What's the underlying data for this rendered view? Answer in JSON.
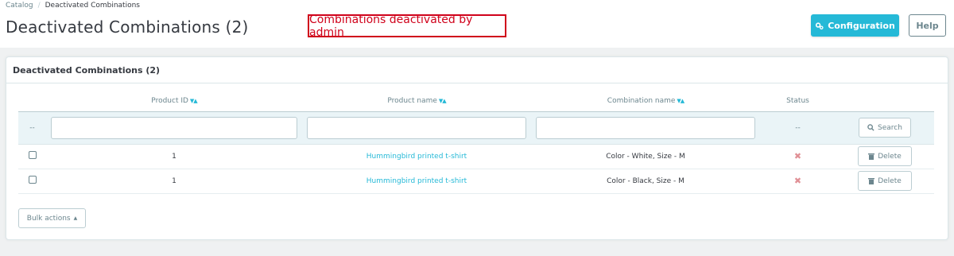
{
  "breadcrumb": {
    "parent": "Catalog",
    "separator": "/",
    "current": "Deactivated Combinations"
  },
  "header": {
    "title": "Deactivated Combinations (2)",
    "annotation": "Combinations deactivated by admin",
    "configuration_label": "Configuration",
    "help_label": "Help"
  },
  "panel": {
    "heading": "Deactivated Combinations (2)"
  },
  "table": {
    "columns": [
      "Product ID",
      "Product name",
      "Combination name",
      "Status"
    ],
    "filter_dash": "--",
    "status_dash": "--",
    "search_label": "Search",
    "rows": [
      {
        "product_id": "1",
        "product_name": "Hummingbird printed t-shirt",
        "combination": "Color - White, Size - M",
        "action": "Delete"
      },
      {
        "product_id": "1",
        "product_name": "Hummingbird printed t-shirt",
        "combination": "Color - Black, Size - M",
        "action": "Delete"
      }
    ]
  },
  "bulk_actions_label": "Bulk actions",
  "colors": {
    "accent": "#25b9d7",
    "annotation": "#d0021b",
    "status_disabled": "#e08f95"
  },
  "icons": {
    "config": "cogs-icon",
    "search": "search-icon",
    "delete": "trash-icon",
    "status": "x-icon",
    "bulk": "caret-up-icon"
  }
}
